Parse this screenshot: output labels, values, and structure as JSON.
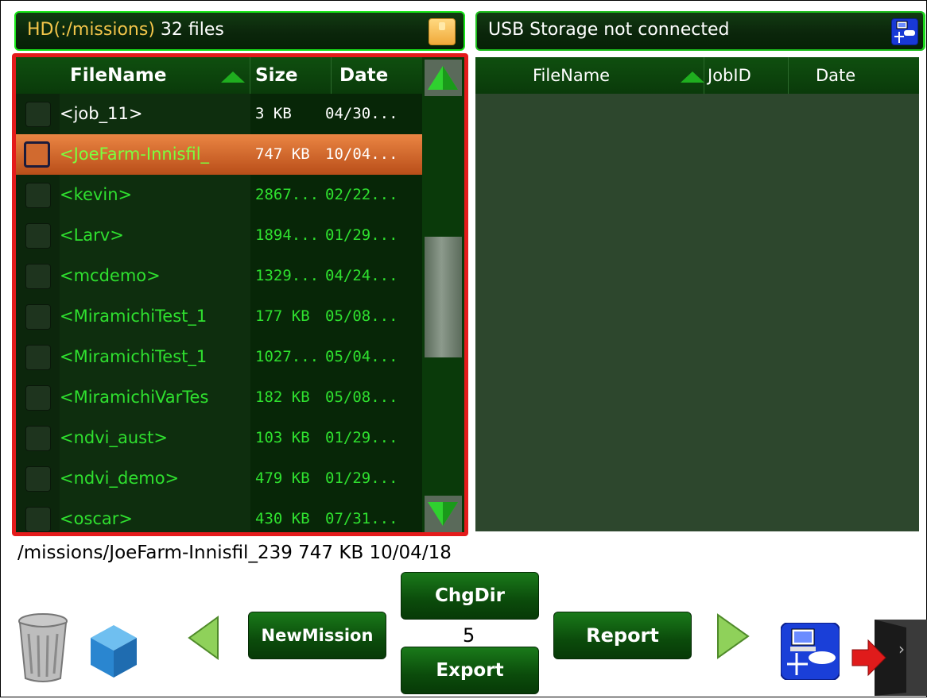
{
  "header_left": {
    "path": "HD(:/missions)",
    "count": "32 files"
  },
  "header_right": {
    "status": "USB Storage not connected"
  },
  "left_table": {
    "columns": [
      "FileName",
      "Size",
      "Date"
    ],
    "rows": [
      {
        "name": "<job_11>",
        "size": "3 KB",
        "date": "04/30...",
        "checked": false,
        "selected": false,
        "color": "#ffffff"
      },
      {
        "name": "<JoeFarm-Innisfil_",
        "size": "747 KB",
        "date": "10/04...",
        "checked": false,
        "selected": true,
        "color": "#7bff3f"
      },
      {
        "name": "<kevin>",
        "size": "2867...",
        "date": "02/22...",
        "checked": false,
        "selected": false,
        "color": "#2fe02f"
      },
      {
        "name": "<Larv>",
        "size": "1894...",
        "date": "01/29...",
        "checked": false,
        "selected": false,
        "color": "#2fe02f"
      },
      {
        "name": "<mcdemo>",
        "size": "1329...",
        "date": "04/24...",
        "checked": false,
        "selected": false,
        "color": "#2fe02f"
      },
      {
        "name": "<MiramichiTest_1",
        "size": "177 KB",
        "date": "05/08...",
        "checked": false,
        "selected": false,
        "color": "#2fe02f"
      },
      {
        "name": "<MiramichiTest_1",
        "size": "1027...",
        "date": "05/04...",
        "checked": false,
        "selected": false,
        "color": "#2fe02f"
      },
      {
        "name": "<MiramichiVarTes",
        "size": "182 KB",
        "date": "05/08...",
        "checked": false,
        "selected": false,
        "color": "#2fe02f"
      },
      {
        "name": "<ndvi_aust>",
        "size": "103 KB",
        "date": "01/29...",
        "checked": false,
        "selected": false,
        "color": "#2fe02f"
      },
      {
        "name": "<ndvi_demo>",
        "size": "479 KB",
        "date": "01/29...",
        "checked": false,
        "selected": false,
        "color": "#2fe02f"
      },
      {
        "name": "<oscar>",
        "size": "430 KB",
        "date": "07/31...",
        "checked": false,
        "selected": false,
        "color": "#2fe02f"
      }
    ]
  },
  "right_table": {
    "columns": [
      "FileName",
      "JobID",
      "Date"
    ]
  },
  "info_line": "/missions/JoeFarm-Innisfil_239  747 KB  10/04/18",
  "toolbar": {
    "chgdir_label": "ChgDir",
    "newmission_label": "NewMission",
    "count": "5",
    "report_label": "Report",
    "export_label": "Export"
  },
  "icons": {
    "trash": "trash-icon",
    "cube": "cube-icon",
    "prev": "prev-arrow-icon",
    "next": "next-arrow-icon",
    "network": "network-icon",
    "exit": "exit-icon"
  },
  "colors": {
    "accent_green": "#19e619",
    "selected_row": "#e07b3b",
    "panel_border": "#e41b1b"
  }
}
